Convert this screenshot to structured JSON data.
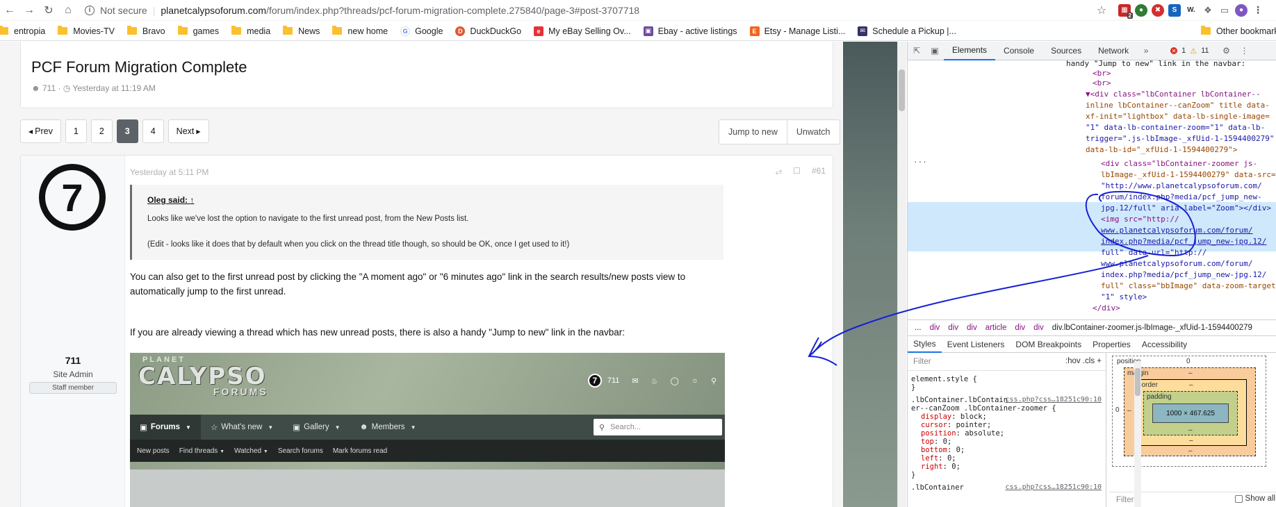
{
  "browser": {
    "security_label": "Not secure",
    "url_host": "planetcalypsoforum.com",
    "url_path": "/forum/index.php?threads/pcf-forum-migration-complete.275840/page-3#post-3707718",
    "bookmarks": [
      {
        "label": "entropia",
        "kind": "folder"
      },
      {
        "label": "Movies-TV",
        "kind": "folder"
      },
      {
        "label": "Bravo",
        "kind": "folder"
      },
      {
        "label": "games",
        "kind": "folder"
      },
      {
        "label": "media",
        "kind": "folder"
      },
      {
        "label": "News",
        "kind": "folder"
      },
      {
        "label": "new home",
        "kind": "folder"
      },
      {
        "label": "Google",
        "kind": "site"
      },
      {
        "label": "DuckDuckGo",
        "kind": "site"
      },
      {
        "label": "My eBay Selling Ov...",
        "kind": "site"
      },
      {
        "label": "Ebay - active listings",
        "kind": "site"
      },
      {
        "label": "Etsy - Manage Listi...",
        "kind": "site"
      },
      {
        "label": "Schedule a Pickup |...",
        "kind": "site"
      }
    ],
    "other_bookmarks": "Other bookmarks",
    "ext_badge": "2"
  },
  "thread": {
    "title": "PCF Forum Migration Complete",
    "author": "711",
    "meta_time": "Yesterday at 11:19 AM"
  },
  "pagination": {
    "prev": "Prev",
    "pages": [
      "1",
      "2",
      "3",
      "4"
    ],
    "current": "3",
    "next": "Next",
    "jump_to_new": "Jump to new",
    "unwatch": "Unwatch"
  },
  "post": {
    "time": "Yesterday at 5:11 PM",
    "number": "#61",
    "user": {
      "avatar_glyph": "7",
      "name": "711",
      "role": "Site Admin",
      "badge": "Staff member"
    },
    "quote": {
      "author": "Oleg said:",
      "line1": "Looks like we've lost the option to navigate to the first unread post, from the New Posts list.",
      "line2": "(Edit - looks like it does that by default when you click on the thread title though, so should be OK, once I get used to it!)"
    },
    "paragraph1": "You can also get to the first unread post by clicking the \"A moment ago\" or \"6 minutes ago\" link in the search results/new posts view to automatically jump to the first unread.",
    "paragraph2": "If you are already viewing a thread which has new unread posts, there is also a handy \"Jump to new\" link in the navbar:"
  },
  "embedded_screenshot": {
    "logo_top": "PLANET",
    "logo_main": "CALYPSO",
    "logo_sub": "FORUMS",
    "username": "711",
    "nav": [
      "Forums",
      "What's new",
      "Gallery",
      "Members"
    ],
    "search_placeholder": "Search...",
    "subnav": [
      "New posts",
      "Find threads",
      "Watched",
      "Search forums",
      "Mark forums read"
    ]
  },
  "devtools": {
    "tabs": [
      "Elements",
      "Console",
      "Sources",
      "Network"
    ],
    "active_tab": "Elements",
    "error_count": "1",
    "warning_count": "11",
    "code_lines": [
      "handy \"Jump to new\" link in the navbar:",
      "<br>",
      "<br>",
      "▼<div class=\"lbContainer lbContainer--",
      "inline lbContainer--canZoom\" title data-",
      "xf-init=\"lightbox\" data-lb-single-image=",
      "\"1\" data-lb-container-zoom=\"1\" data-lb-",
      "trigger=\".js-lbImage-_xfUid-1-1594400279\"",
      "data-lb-id=\"_xfUid-1-1594400279\">",
      "<div class=\"lbContainer-zoomer js-",
      "lbImage-_xfUid-1-1594400279\" data-src=",
      "\"http://www.planetcalypsoforum.com/",
      "forum/index.php?media/pcf_jump_new-",
      "jpg.12/full\" aria-label=\"Zoom\"></div>",
      "<img src=\"http://",
      "www.planetcalypsoforum.com/forum/",
      "index.php?media/pcf_jump_new-jpg.12/",
      "full\" data-url=\"http://",
      "www.planetcalypsoforum.com/forum/",
      "index.php?media/pcf_jump_new-jpg.12/",
      "full\" class=\"bbImage\" data-zoom-target=",
      "\"1\" style>",
      "</div>"
    ],
    "breadcrumb": [
      "...",
      "div",
      "div",
      "div",
      "article",
      "div",
      "div"
    ],
    "breadcrumb_last": "div.lbContainer-zoomer.js-lbImage-_xfUid-1-1594400279",
    "subtabs": [
      "Styles",
      "Event Listeners",
      "DOM Breakpoints",
      "Properties",
      "Accessibility"
    ],
    "filter_placeholder": "Filter",
    "filter_tools": ":hov  .cls  +",
    "styles": {
      "element_style": "element.style {",
      "close": "}",
      "rule_selector_1": ".lbContainer.lbContain",
      "rule_selector_2": "er--canZoom .lbContainer-zoomer {",
      "rule_source": "css.php?css…18251c90:10",
      "props": [
        {
          "name": "display",
          "value": "block;"
        },
        {
          "name": "cursor",
          "value": "pointer;"
        },
        {
          "name": "position",
          "value": "absolute;"
        },
        {
          "name": "top",
          "value": "0;"
        },
        {
          "name": "bottom",
          "value": "0;"
        },
        {
          "name": "left",
          "value": "0;"
        },
        {
          "name": "right",
          "value": "0;"
        }
      ],
      "next_selector": ".lbContainer",
      "next_source": "css.php?css…18251c90:10"
    },
    "boxmodel": {
      "position_label": "position",
      "position_value": "0",
      "margin_label": "margin",
      "border_label": "border",
      "padding_label": "padding",
      "content": "1000 × 467.625",
      "dash": "–",
      "zero": "0",
      "filter_placeholder": "Filter",
      "show_all": "Show all"
    }
  },
  "colors": {
    "annotation_ink": "#1520d6",
    "devtools_accent": "#1a73e8",
    "active_page": "#5d6268"
  }
}
